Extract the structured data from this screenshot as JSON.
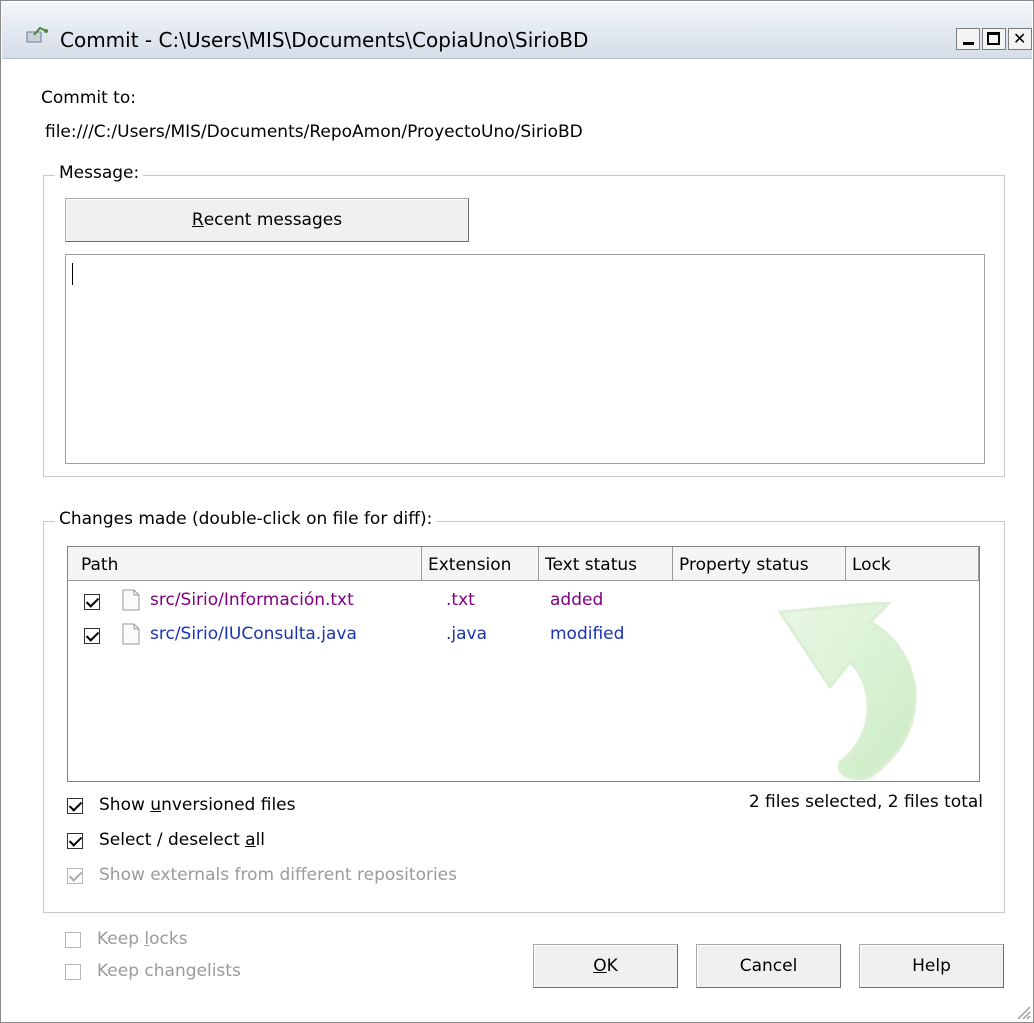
{
  "window": {
    "title": "Commit - C:\\Users\\MIS\\Documents\\CopiaUno\\SirioBD",
    "controls": {
      "minimize": "_",
      "maximize": "□",
      "close": "✕"
    }
  },
  "commit_to": {
    "label": "Commit to:",
    "url": "file:///C:/Users/MIS/Documents/RepoAmon/ProyectoUno/SirioBD"
  },
  "message": {
    "legend": "Message:",
    "recent_button": {
      "accel": "R",
      "rest": "ecent messages"
    },
    "value": ""
  },
  "changes": {
    "legend": "Changes made (double-click on file for diff):",
    "columns": [
      "Path",
      "Extension",
      "Text status",
      "Property status",
      "Lock"
    ],
    "files": [
      {
        "checked": true,
        "path": "src/Sirio/Información.txt",
        "extension": ".txt",
        "text_status": "added",
        "property_status": "",
        "lock": ""
      },
      {
        "checked": true,
        "path": "src/Sirio/IUConsulta.java",
        "extension": ".java",
        "text_status": "modified",
        "property_status": "",
        "lock": ""
      }
    ],
    "summary": "2 files selected, 2 files total"
  },
  "options": {
    "show_unversioned": {
      "checked": true,
      "pre": "Show ",
      "accel": "u",
      "post": "nversioned files"
    },
    "select_all": {
      "checked": true,
      "pre": "Select / deselect ",
      "accel": "a",
      "post": "ll"
    },
    "show_externals": {
      "checked": true,
      "disabled": true,
      "label": "Show externals from different repositories"
    }
  },
  "bottom": {
    "keep_locks": {
      "checked": false,
      "disabled": true,
      "pre": "Keep ",
      "accel": "l",
      "post": "ocks"
    },
    "keep_changelists": {
      "checked": false,
      "disabled": true,
      "label": "Keep changelists"
    },
    "ok": {
      "accel": "O",
      "rest": "K"
    },
    "cancel": "Cancel",
    "help": "Help"
  },
  "colors": {
    "added": "#800080",
    "modified": "#1a33b3",
    "disabled": "#9a9a9a"
  },
  "icons": [
    "commit-icon",
    "file-icon",
    "commit-arrow-watermark",
    "resize-grip-icon"
  ]
}
